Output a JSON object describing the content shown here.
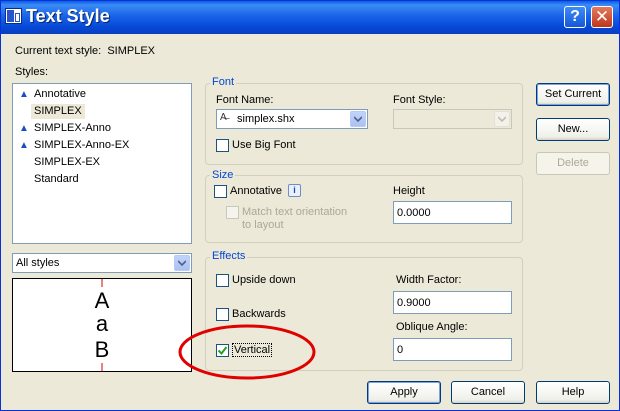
{
  "title": "Text Style",
  "title_buttons": {
    "help": "?",
    "close": "✕"
  },
  "current_style": {
    "label": "Current text style:",
    "value": "SIMPLEX"
  },
  "styles": {
    "label": "Styles:",
    "items": [
      {
        "label": "Annotative",
        "annotative": true
      },
      {
        "label": "SIMPLEX",
        "annotative": false,
        "selected": true
      },
      {
        "label": "SIMPLEX-Anno",
        "annotative": true
      },
      {
        "label": "SIMPLEX-Anno-EX",
        "annotative": true
      },
      {
        "label": "SIMPLEX-EX",
        "annotative": false
      },
      {
        "label": "Standard",
        "annotative": false
      }
    ],
    "filter": "All styles"
  },
  "font": {
    "group": "Font",
    "name_label": "Font Name:",
    "name_value": "simplex.shx",
    "style_label": "Font Style:",
    "style_value": "",
    "big_font_label": "Use Big Font",
    "big_font_checked": false
  },
  "size": {
    "group": "Size",
    "annotative_label": "Annotative",
    "annotative_checked": false,
    "info": "i",
    "match_label_1": "Match text orientation",
    "match_label_2": "to layout",
    "height_label": "Height",
    "height_value": "0.0000"
  },
  "effects": {
    "group": "Effects",
    "upside_down_label": "Upside down",
    "upside_down_checked": false,
    "backwards_label": "Backwards",
    "backwards_checked": false,
    "vertical_label": "Vertical",
    "vertical_checked": true,
    "width_label": "Width Factor:",
    "width_value": "0.9000",
    "oblique_label": "Oblique Angle:",
    "oblique_value": "0"
  },
  "preview": {
    "chars": [
      "A",
      "a",
      "B"
    ]
  },
  "buttons": {
    "set_current": "Set Current",
    "new": "New...",
    "delete": "Delete",
    "apply": "Apply",
    "cancel": "Cancel",
    "help": "Help"
  },
  "colors": {
    "accent": "#0046D5",
    "annotation": "#E00000",
    "titlebar": "#0A5CE6"
  }
}
